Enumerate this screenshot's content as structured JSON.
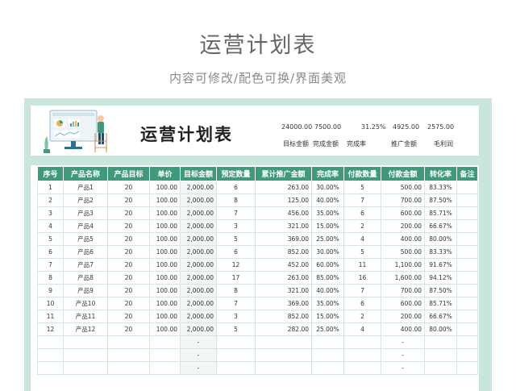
{
  "title": "运营计划表",
  "subtitle": "内容可修改/配色可换/界面美观",
  "sheet": {
    "title": "运营计划表",
    "kpis": [
      {
        "value": "24000.00",
        "label": "目标金额"
      },
      {
        "value": "7500.00",
        "label": "完成金额"
      },
      {
        "value": "31.25%",
        "label": "完成率"
      },
      {
        "value": "4925.00",
        "label": "推广金额"
      },
      {
        "value": "2575.00",
        "label": "毛利润"
      }
    ]
  },
  "table": {
    "headers": [
      "序号",
      "产品名称",
      "产品目标",
      "单价",
      "目标金额",
      "预定数量",
      "累计推广金额",
      "完成率",
      "付款数量",
      "付款金额",
      "转化率",
      "备注"
    ],
    "rows": [
      [
        "1",
        "产品1",
        "20",
        "100.00",
        "2,000.00",
        "6",
        "263.00",
        "30.00%",
        "5",
        "500.00",
        "83.33%",
        ""
      ],
      [
        "2",
        "产品2",
        "20",
        "100.00",
        "2,000.00",
        "8",
        "125.00",
        "40.00%",
        "7",
        "700.00",
        "87.50%",
        ""
      ],
      [
        "3",
        "产品3",
        "20",
        "100.00",
        "2,000.00",
        "7",
        "456.00",
        "35.00%",
        "6",
        "600.00",
        "85.71%",
        ""
      ],
      [
        "4",
        "产品4",
        "20",
        "100.00",
        "2,000.00",
        "3",
        "321.00",
        "15.00%",
        "2",
        "200.00",
        "66.67%",
        ""
      ],
      [
        "5",
        "产品5",
        "20",
        "100.00",
        "2,000.00",
        "5",
        "369.00",
        "25.00%",
        "4",
        "400.00",
        "80.00%",
        ""
      ],
      [
        "6",
        "产品6",
        "20",
        "100.00",
        "2,000.00",
        "6",
        "852.00",
        "30.00%",
        "5",
        "500.00",
        "83.33%",
        ""
      ],
      [
        "7",
        "产品7",
        "20",
        "100.00",
        "2,000.00",
        "12",
        "452.00",
        "60.00%",
        "11",
        "1,100.00",
        "91.67%",
        ""
      ],
      [
        "8",
        "产品8",
        "20",
        "100.00",
        "2,000.00",
        "17",
        "263.00",
        "85.00%",
        "16",
        "1,600.00",
        "94.12%",
        ""
      ],
      [
        "9",
        "产品9",
        "20",
        "100.00",
        "2,000.00",
        "8",
        "321.00",
        "40.00%",
        "7",
        "700.00",
        "87.50%",
        ""
      ],
      [
        "10",
        "产品10",
        "20",
        "100.00",
        "2,000.00",
        "7",
        "369.00",
        "35.00%",
        "6",
        "600.00",
        "85.71%",
        ""
      ],
      [
        "11",
        "产品11",
        "20",
        "100.00",
        "2,000.00",
        "3",
        "852.00",
        "15.00%",
        "2",
        "200.00",
        "66.67%",
        ""
      ],
      [
        "12",
        "产品12",
        "20",
        "100.00",
        "2,000.00",
        "5",
        "282.00",
        "25.00%",
        "4",
        "400.00",
        "80.00%",
        ""
      ],
      [
        "",
        "",
        "",
        "",
        "-",
        "",
        "",
        "",
        "",
        "-",
        "",
        ""
      ],
      [
        "",
        "",
        "",
        "",
        "-",
        "",
        "",
        "",
        "",
        "-",
        "",
        ""
      ],
      [
        "",
        "",
        "",
        "",
        "-",
        "",
        "",
        "",
        "",
        "-",
        "",
        ""
      ]
    ]
  },
  "colors": {
    "accent": "#3f9a7a",
    "frame": "#c9e6dc"
  }
}
